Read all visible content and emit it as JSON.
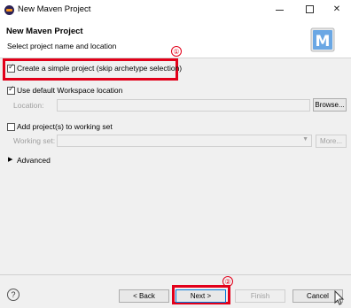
{
  "window": {
    "title": "New Maven Project"
  },
  "header": {
    "title": "New Maven Project",
    "description": "Select project name and location"
  },
  "options": {
    "simple_project": {
      "label": "Create a simple project (skip archetype selection)",
      "checked": true
    },
    "default_workspace": {
      "label": "Use default Workspace location",
      "checked": true
    },
    "location_label": "Location:",
    "location_value": "",
    "browse_label": "Browse...",
    "working_set": {
      "label": "Add project(s) to working set",
      "checked": false
    },
    "working_set_label": "Working set:",
    "more_label": "More...",
    "advanced_label": "Advanced"
  },
  "annotations": {
    "one": "①",
    "two": "②"
  },
  "buttons": {
    "back": "< Back",
    "next": "Next >",
    "finish": "Finish",
    "cancel": "Cancel"
  },
  "colors": {
    "annotation": "#e2001a",
    "maven_logo": "#4a90d9"
  }
}
